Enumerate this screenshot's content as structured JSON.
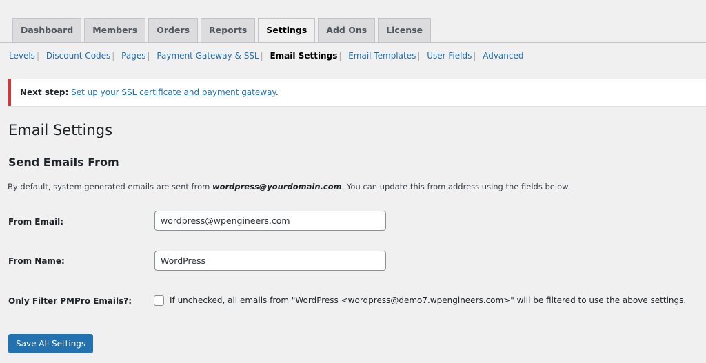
{
  "tabs": [
    {
      "label": "Dashboard",
      "active": false
    },
    {
      "label": "Members",
      "active": false
    },
    {
      "label": "Orders",
      "active": false
    },
    {
      "label": "Reports",
      "active": false
    },
    {
      "label": "Settings",
      "active": true
    },
    {
      "label": "Add Ons",
      "active": false
    },
    {
      "label": "License",
      "active": false
    }
  ],
  "subnav": {
    "items": [
      "Levels",
      "Discount Codes",
      "Pages",
      "Payment Gateway & SSL",
      "Email Settings",
      "Email Templates",
      "User Fields",
      "Advanced"
    ],
    "current": "Email Settings",
    "separator": "|"
  },
  "notice": {
    "prefix": "Next step:",
    "link": "Set up your SSL certificate and payment gateway",
    "suffix": "."
  },
  "page": {
    "title": "Email Settings",
    "section_title": "Send Emails From",
    "description_before": "By default, system generated emails are sent from ",
    "description_email": "wordpress@yourdomain.com",
    "description_after": ". You can update this from address using the fields below."
  },
  "fields": {
    "from_email_label": "From Email:",
    "from_email_value": "wordpress@wpengineers.com",
    "from_name_label": "From Name:",
    "from_name_value": "WordPress",
    "filter_label": "Only Filter PMPro Emails?:",
    "filter_checked": false,
    "filter_description": "If unchecked, all emails from \"WordPress <wordpress@demo7.wpengineers.com>\" will be filtered to use the above settings."
  },
  "save_button": "Save All Settings",
  "colors": {
    "accent": "#2271b1",
    "notice_error": "#d63638",
    "background": "#f0f0f1"
  }
}
